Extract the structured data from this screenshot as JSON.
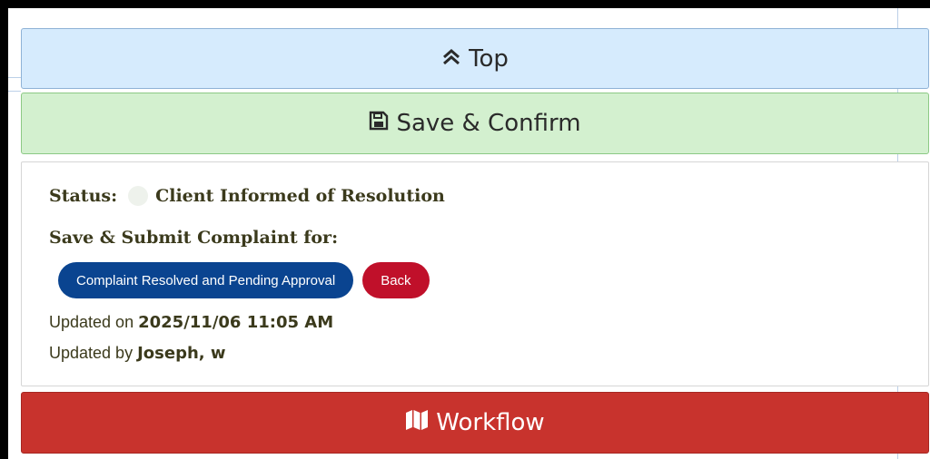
{
  "buttons": {
    "top_label": "Top",
    "save_label": "Save & Confirm",
    "workflow_label": "Workflow"
  },
  "status": {
    "label": "Status:",
    "value": "Client Informed of Resolution"
  },
  "submit": {
    "label": "Save & Submit Complaint for:",
    "actions": [
      {
        "label": "Complaint Resolved and Pending Approval",
        "color": "#0a4490"
      },
      {
        "label": "Back",
        "color": "#c0102a"
      }
    ]
  },
  "meta": {
    "updated_on_label": "Updated on",
    "updated_on_value": "2025/11/06 11:05 AM",
    "updated_by_label": "Updated by",
    "updated_by_value": "Joseph, w"
  },
  "icons": {
    "top": "double-chevron-up-icon",
    "save": "floppy-disk-icon",
    "workflow": "map-icon"
  },
  "colors": {
    "top_bg": "#d6ebfd",
    "save_bg": "#d3f0cf",
    "workflow_bg": "#c8332d"
  }
}
